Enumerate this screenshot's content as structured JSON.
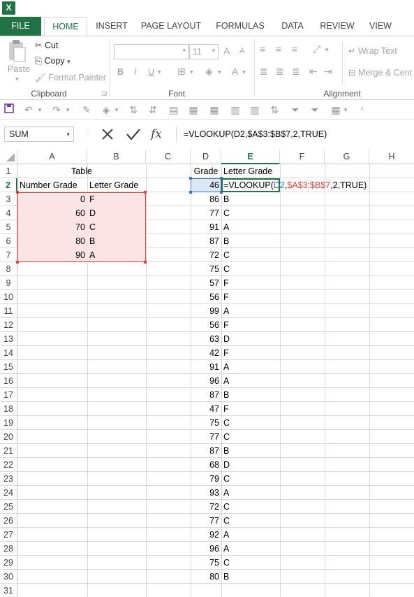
{
  "app": {
    "logo": "X"
  },
  "tabs": [
    "FILE",
    "HOME",
    "INSERT",
    "PAGE LAYOUT",
    "FORMULAS",
    "DATA",
    "REVIEW",
    "VIEW"
  ],
  "ribbon": {
    "clipboard": {
      "paste": "Paste",
      "cut": "Cut",
      "copy": "Copy",
      "format_painter": "Format Painter",
      "label": "Clipboard"
    },
    "font": {
      "size": "11",
      "grow": "A",
      "shrink": "A",
      "bold": "B",
      "italic": "I",
      "underline": "U",
      "font_color": "A",
      "label": "Font"
    },
    "alignment": {
      "wrap_text": "Wrap Text",
      "merge": "Merge & Cent",
      "label": "Alignment"
    }
  },
  "formula_bar": {
    "name_box": "SUM",
    "fx": "fx",
    "formula": "=VLOOKUP(D2,$A$3:$B$7,2,TRUE)"
  },
  "columns": [
    "A",
    "B",
    "C",
    "D",
    "E",
    "F",
    "G",
    "H"
  ],
  "rows": [
    "1",
    "2",
    "3",
    "4",
    "5",
    "6",
    "7",
    "8",
    "9",
    "10",
    "11",
    "12",
    "13",
    "14",
    "15",
    "16",
    "17",
    "18",
    "19",
    "20",
    "21",
    "22",
    "23",
    "24",
    "25",
    "26",
    "27",
    "28",
    "29",
    "30",
    "31"
  ],
  "sheet": {
    "table_title": "Table",
    "col_a_header": "Number Grade",
    "col_b_header": "Letter Grade",
    "lookup": [
      {
        "num": "0",
        "letter": "F"
      },
      {
        "num": "60",
        "letter": "D"
      },
      {
        "num": "70",
        "letter": "C"
      },
      {
        "num": "80",
        "letter": "B"
      },
      {
        "num": "90",
        "letter": "A"
      }
    ],
    "grade_header": "Grade",
    "letter_header": "Letter Grade",
    "editing_formula": {
      "prefix": "=VLOOKUP(",
      "ref1": "D2",
      "comma1": ",",
      "ref2": "$A$3:$B$7",
      "suffix": ",2,TRUE)"
    },
    "grades": [
      {
        "grade": "46",
        "letter": ""
      },
      {
        "grade": "86",
        "letter": "B"
      },
      {
        "grade": "77",
        "letter": "C"
      },
      {
        "grade": "91",
        "letter": "A"
      },
      {
        "grade": "87",
        "letter": "B"
      },
      {
        "grade": "72",
        "letter": "C"
      },
      {
        "grade": "75",
        "letter": "C"
      },
      {
        "grade": "57",
        "letter": "F"
      },
      {
        "grade": "56",
        "letter": "F"
      },
      {
        "grade": "99",
        "letter": "A"
      },
      {
        "grade": "56",
        "letter": "F"
      },
      {
        "grade": "63",
        "letter": "D"
      },
      {
        "grade": "42",
        "letter": "F"
      },
      {
        "grade": "91",
        "letter": "A"
      },
      {
        "grade": "96",
        "letter": "A"
      },
      {
        "grade": "87",
        "letter": "B"
      },
      {
        "grade": "47",
        "letter": "F"
      },
      {
        "grade": "75",
        "letter": "C"
      },
      {
        "grade": "77",
        "letter": "C"
      },
      {
        "grade": "87",
        "letter": "B"
      },
      {
        "grade": "68",
        "letter": "D"
      },
      {
        "grade": "79",
        "letter": "C"
      },
      {
        "grade": "93",
        "letter": "A"
      },
      {
        "grade": "72",
        "letter": "C"
      },
      {
        "grade": "77",
        "letter": "C"
      },
      {
        "grade": "92",
        "letter": "A"
      },
      {
        "grade": "96",
        "letter": "A"
      },
      {
        "grade": "75",
        "letter": "C"
      },
      {
        "grade": "80",
        "letter": "B"
      }
    ]
  },
  "colors": {
    "excel_green": "#217346",
    "ref_blue": "#4472c4",
    "ref_red": "#e0443e",
    "range_fill": "#fce4e4",
    "active_fill": "#dde8f7"
  }
}
